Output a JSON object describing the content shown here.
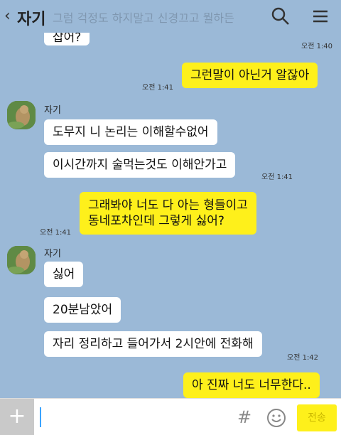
{
  "header": {
    "back_glyph": "‹",
    "title": "자기",
    "overlay_text": "그럼 걱정도 하지말고 신경끄고 뭘하든"
  },
  "messages": [
    {
      "side": "in",
      "text": "잡어?",
      "time": "오전 1:40"
    },
    {
      "side": "out",
      "text": "그런말이 아닌거 알잖아",
      "time": "오전 1:41"
    },
    {
      "side": "in",
      "sender": "자기",
      "text": "도무지 니 논리는 이해할수없어"
    },
    {
      "side": "in",
      "text": "이시간까지 술먹는것도 이해안가고",
      "time": "오전 1:41"
    },
    {
      "side": "out",
      "text_lines": [
        "그래봐야 너도 다 아는 형들이고",
        "동네포차인데 그렇게 싫어?"
      ],
      "time": "오전 1:41"
    },
    {
      "side": "in",
      "sender": "자기",
      "text": "싫어"
    },
    {
      "side": "in",
      "text": "20분남았어"
    },
    {
      "side": "in",
      "text": "자리 정리하고 들어가서 2시안에 전화해",
      "time": "오전 1:42"
    },
    {
      "side": "out",
      "text": "아 진짜 너도 너무한다.."
    }
  ],
  "input": {
    "plus_label": "+",
    "hash_label": "#",
    "send_label": "전송"
  },
  "icons": {
    "back": "chevron-left-icon",
    "search": "search-icon",
    "menu": "hamburger-menu-icon",
    "emoji": "smiley-icon",
    "avatar": "profile-photo"
  },
  "colors": {
    "background": "#9bb9d7",
    "outgoing_bubble": "#fef01b",
    "incoming_bubble": "#ffffff"
  }
}
